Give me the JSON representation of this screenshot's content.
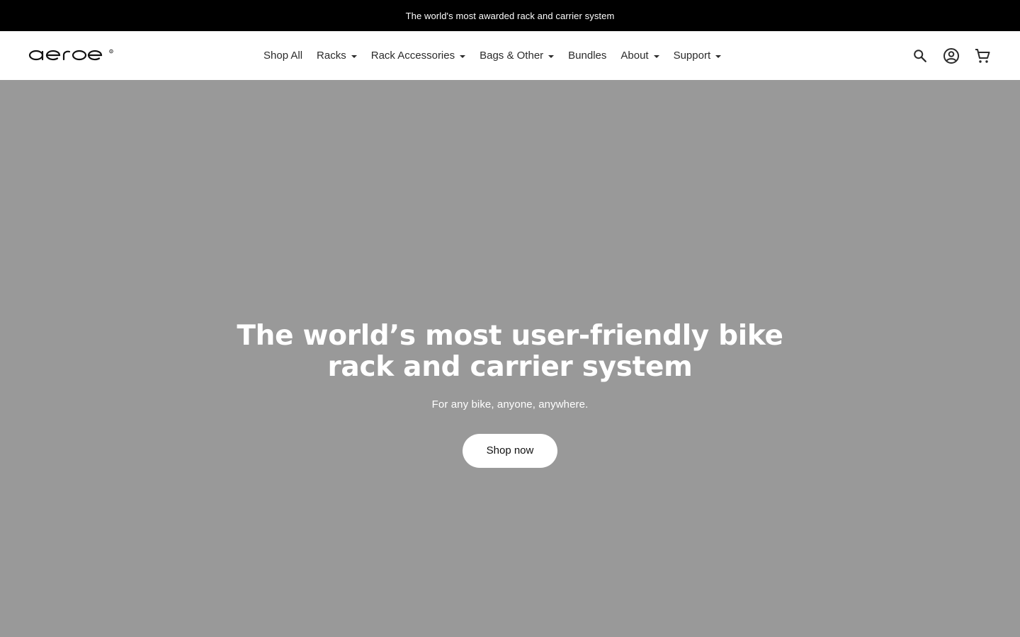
{
  "announcement": {
    "text": "The world's most awarded rack and carrier system"
  },
  "header": {
    "logo_text": "aeroe",
    "nav": [
      {
        "label": "Shop All",
        "dropdown": false
      },
      {
        "label": "Racks",
        "dropdown": true
      },
      {
        "label": "Rack Accessories",
        "dropdown": true
      },
      {
        "label": "Bags & Other",
        "dropdown": true
      },
      {
        "label": "Bundles",
        "dropdown": false
      },
      {
        "label": "About",
        "dropdown": true
      },
      {
        "label": "Support",
        "dropdown": true
      }
    ],
    "icons": [
      "search-icon",
      "account-icon",
      "cart-icon"
    ]
  },
  "hero": {
    "title": "The world’s most user-friendly bike rack and carrier system",
    "subtitle": "For any bike, anyone, anywhere.",
    "cta_label": "Shop now",
    "background_color": "#999999"
  },
  "colors": {
    "announcement_bg": "#000000",
    "header_bg": "#ffffff",
    "text": "#2b2b2b",
    "button_bg": "#ffffff"
  }
}
